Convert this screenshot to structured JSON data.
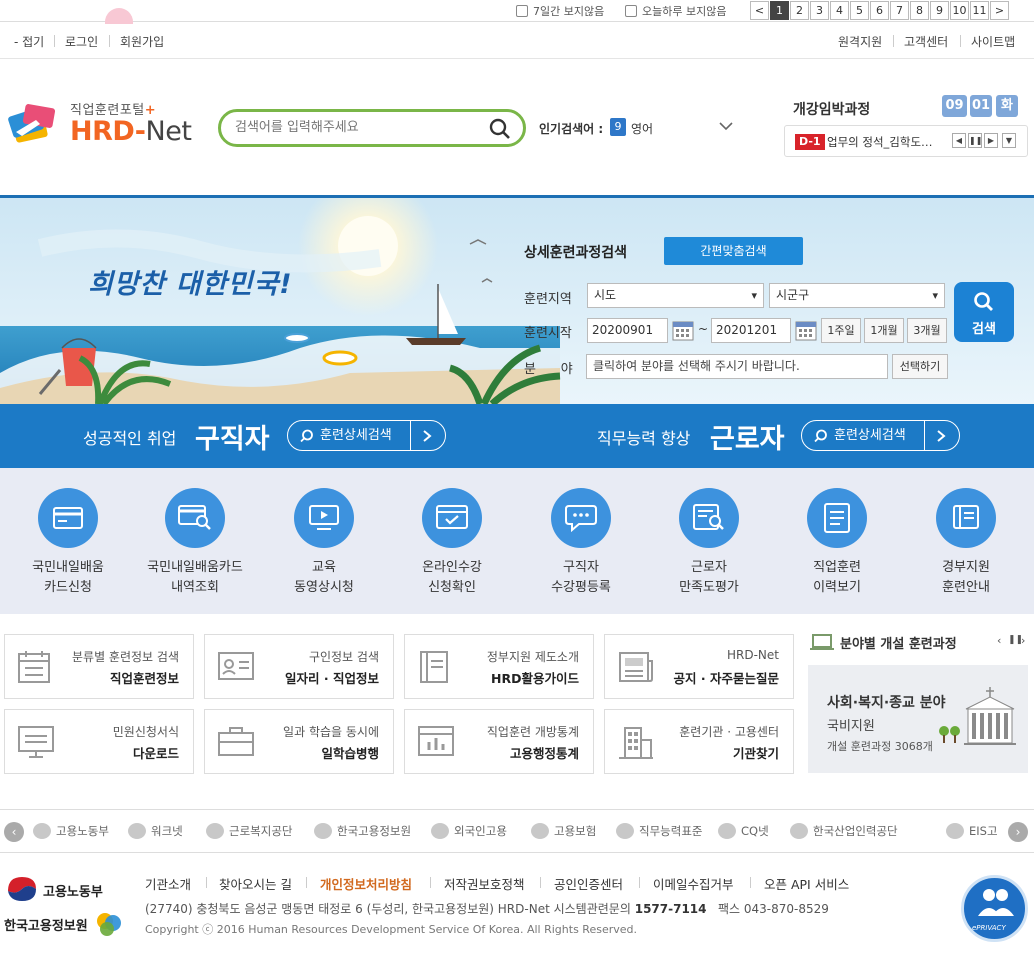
{
  "topbar": {
    "hide_7days": "7일간 보지않음",
    "hide_today": "오늘하루 보지않음",
    "pages": [
      "1",
      "2",
      "3",
      "4",
      "5",
      "6",
      "7",
      "8",
      "9",
      "10",
      "11"
    ],
    "prev": "<",
    "next": ">"
  },
  "util": {
    "collapse": "- 접기",
    "login": "로그인",
    "signup": "회원가입",
    "remote": "원격지원",
    "support": "고객센터",
    "sitemap": "사이트맵"
  },
  "header": {
    "logo_sub": "직업훈련포털",
    "logo_hrd": "HRD-",
    "logo_net": "Net",
    "search_placeholder": "검색어를 입력해주세요",
    "popular_label": "인기검색어 :",
    "popular_rank": "9",
    "popular_word": "영어",
    "imminent_title": "개강임박과정",
    "month": "09",
    "day": "01",
    "weekday": "화",
    "dday": "D-1",
    "course_name": "업무의 정석_김학도…"
  },
  "hero": {
    "slogan": "희망찬 대한민국!",
    "form_title": "상세훈련과정검색",
    "simple_search": "간편맞춤검색",
    "region_label": "훈련지역",
    "sido": "시도",
    "sigungu": "시군구",
    "start_label": "훈련시작",
    "date_from": "20200901",
    "tilde": "~",
    "date_to": "20201201",
    "week1": "1주일",
    "month1": "1개월",
    "month3": "3개월",
    "field_label": "분      야",
    "field_placeholder": "클릭하여 분야를 선택해 주시기 바랍니다.",
    "select_btn": "선택하기",
    "search_btn": "검색"
  },
  "band": {
    "left_lead": "성공적인 취업",
    "left_big": "구직자",
    "left_btn": "훈련상세검색",
    "right_lead": "직무능력 향상",
    "right_big": "근로자",
    "right_btn": "훈련상세검색"
  },
  "quick": [
    {
      "l1": "국민내일배움",
      "l2": "카드신청"
    },
    {
      "l1": "국민내일배움카드",
      "l2": "내역조회"
    },
    {
      "l1": "교육",
      "l2": "동영상시청"
    },
    {
      "l1": "온라인수강",
      "l2": "신청확인"
    },
    {
      "l1": "구직자",
      "l2": "수강평등록"
    },
    {
      "l1": "근로자",
      "l2": "만족도평가"
    },
    {
      "l1": "직업훈련",
      "l2": "이력보기"
    },
    {
      "l1": "경부지원",
      "l2": "훈련안내"
    }
  ],
  "tiles": [
    {
      "t1": "분류별 훈련정보 검색",
      "t2": "직업훈련정보"
    },
    {
      "t1": "구인정보 검색",
      "t2": "일자리 · 직업정보"
    },
    {
      "t1": "정부지원 제도소개",
      "t2": "HRD활용가이드"
    },
    {
      "t1": "HRD-Net",
      "t2": "공지 · 자주묻는질문"
    },
    {
      "t1": "민원신청서식",
      "t2": "다운로드"
    },
    {
      "t1": "일과 학습을 동시에",
      "t2": "일학습병행"
    },
    {
      "t1": "직업훈련 개방통계",
      "t2": "고용행정통계"
    },
    {
      "t1": "훈련기관 · 고용센터",
      "t2": "기관찾기"
    }
  ],
  "field_box": {
    "title": "분야별 개설 훈련과정",
    "category": "사회·복지·종교 분야",
    "support": "국비지원",
    "count_text": "개설 훈련과정 3068개"
  },
  "partners": [
    "고용노동부",
    "워크넷",
    "근로복지공단",
    "한국고용정보원",
    "외국인고용",
    "고용보험",
    "직무능력표준",
    "CQ넷",
    "한국산업인력공단",
    "EIS고"
  ],
  "footer": {
    "moel": "고용노동부",
    "keis": "한국고용정보원",
    "links": [
      "기관소개",
      "찾아오시는 길",
      "개인정보처리방침",
      "저작권보호정책",
      "공인인증센터",
      "이메일수집거부",
      "오픈 API 서비스"
    ],
    "address": "(27740) 충청북도 음성군 맹동면 태정로 6 (두성리, 한국고용정보원) HRD-Net 시스템관련문의",
    "phone": "1577-7114",
    "fax": "팩스 043-870-8529",
    "copyright": "Copyright ⓒ 2016 Human Resources Development Service Of Korea. All Rights Reserved.",
    "privacy_badge": "ePRIVACY"
  },
  "colors": {
    "brand_orange": "#f26522",
    "primary_blue": "#1c7ac6",
    "search_green": "#7ab648",
    "dday_red": "#d8232a"
  }
}
